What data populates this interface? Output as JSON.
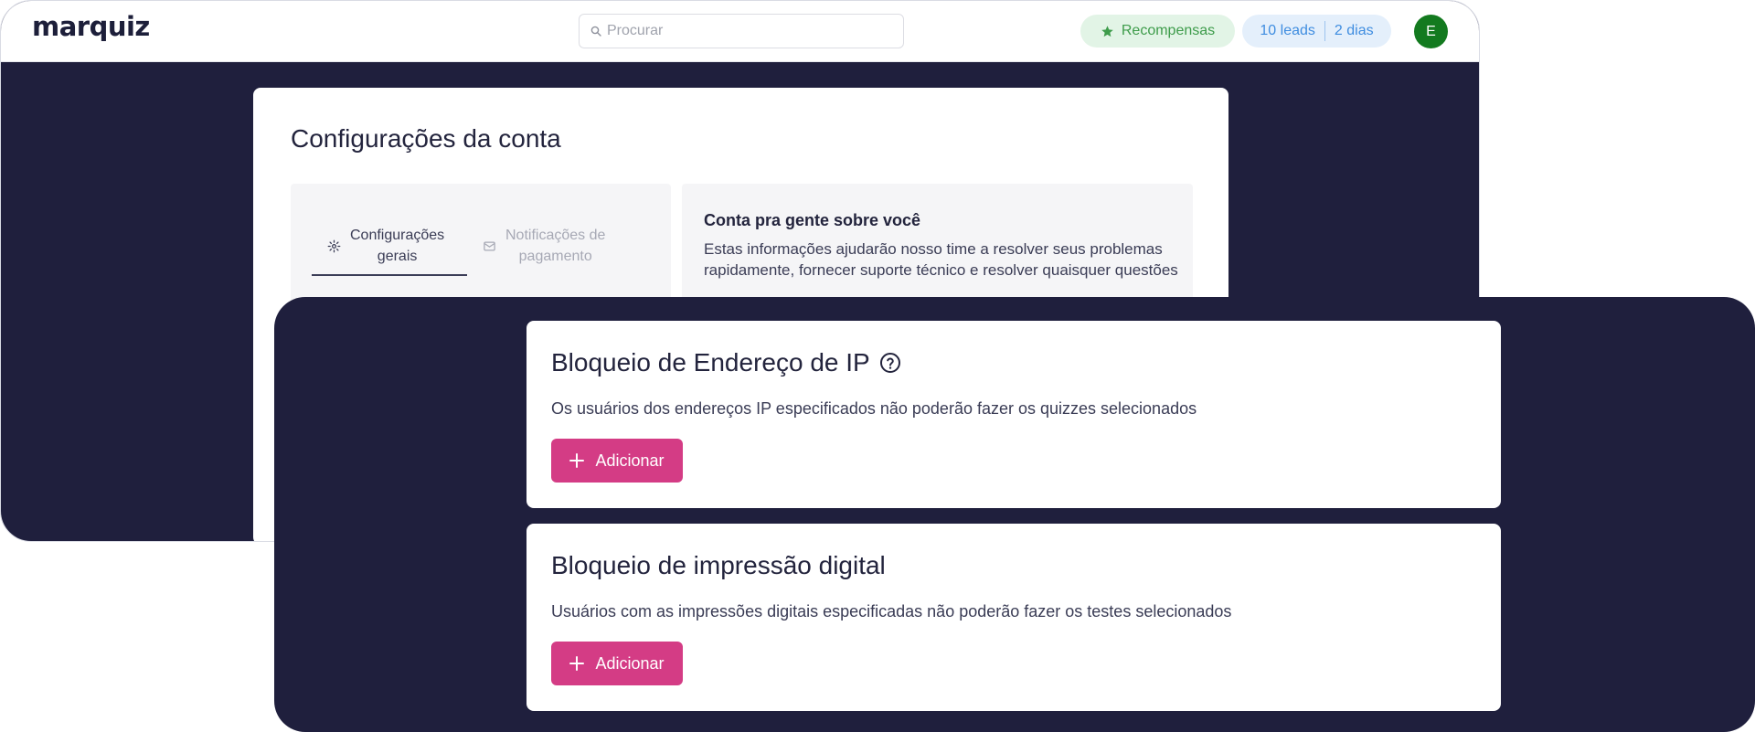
{
  "header": {
    "logo": "marquiz",
    "search_placeholder": "Procurar",
    "rewards_label": "Recompensas",
    "leads_label": "10 leads",
    "days_label": "2 dias",
    "avatar_initial": "E"
  },
  "settings": {
    "title": "Configurações da conta",
    "tabs": [
      {
        "label_line1": "Configurações",
        "label_line2": "gerais"
      },
      {
        "label_line1": "Notificações de",
        "label_line2": "pagamento"
      }
    ],
    "info_title": "Conta pra gente sobre você",
    "info_text": "Estas informações ajudarão nosso time a resolver seus problemas rapidamente, fornecer suporte técnico e resolver quaisquer questões"
  },
  "blocks": {
    "ip": {
      "title": "Bloqueio de Endereço de IP",
      "description": "Os usuários dos endereços IP especificados não poderão fazer os quizzes selecionados",
      "button_label": "Adicionar"
    },
    "fingerprint": {
      "title": "Bloqueio de impressão digital",
      "description": "Usuários com as impressões digitais especificadas não poderão fazer os testes selecionados",
      "button_label": "Adicionar"
    }
  },
  "colors": {
    "dark_bg": "#1f1f3d",
    "accent_button": "#d43c85",
    "rewards_green": "#3e9c4b",
    "leads_blue": "#3f8de0",
    "avatar_green": "#137a1f"
  }
}
